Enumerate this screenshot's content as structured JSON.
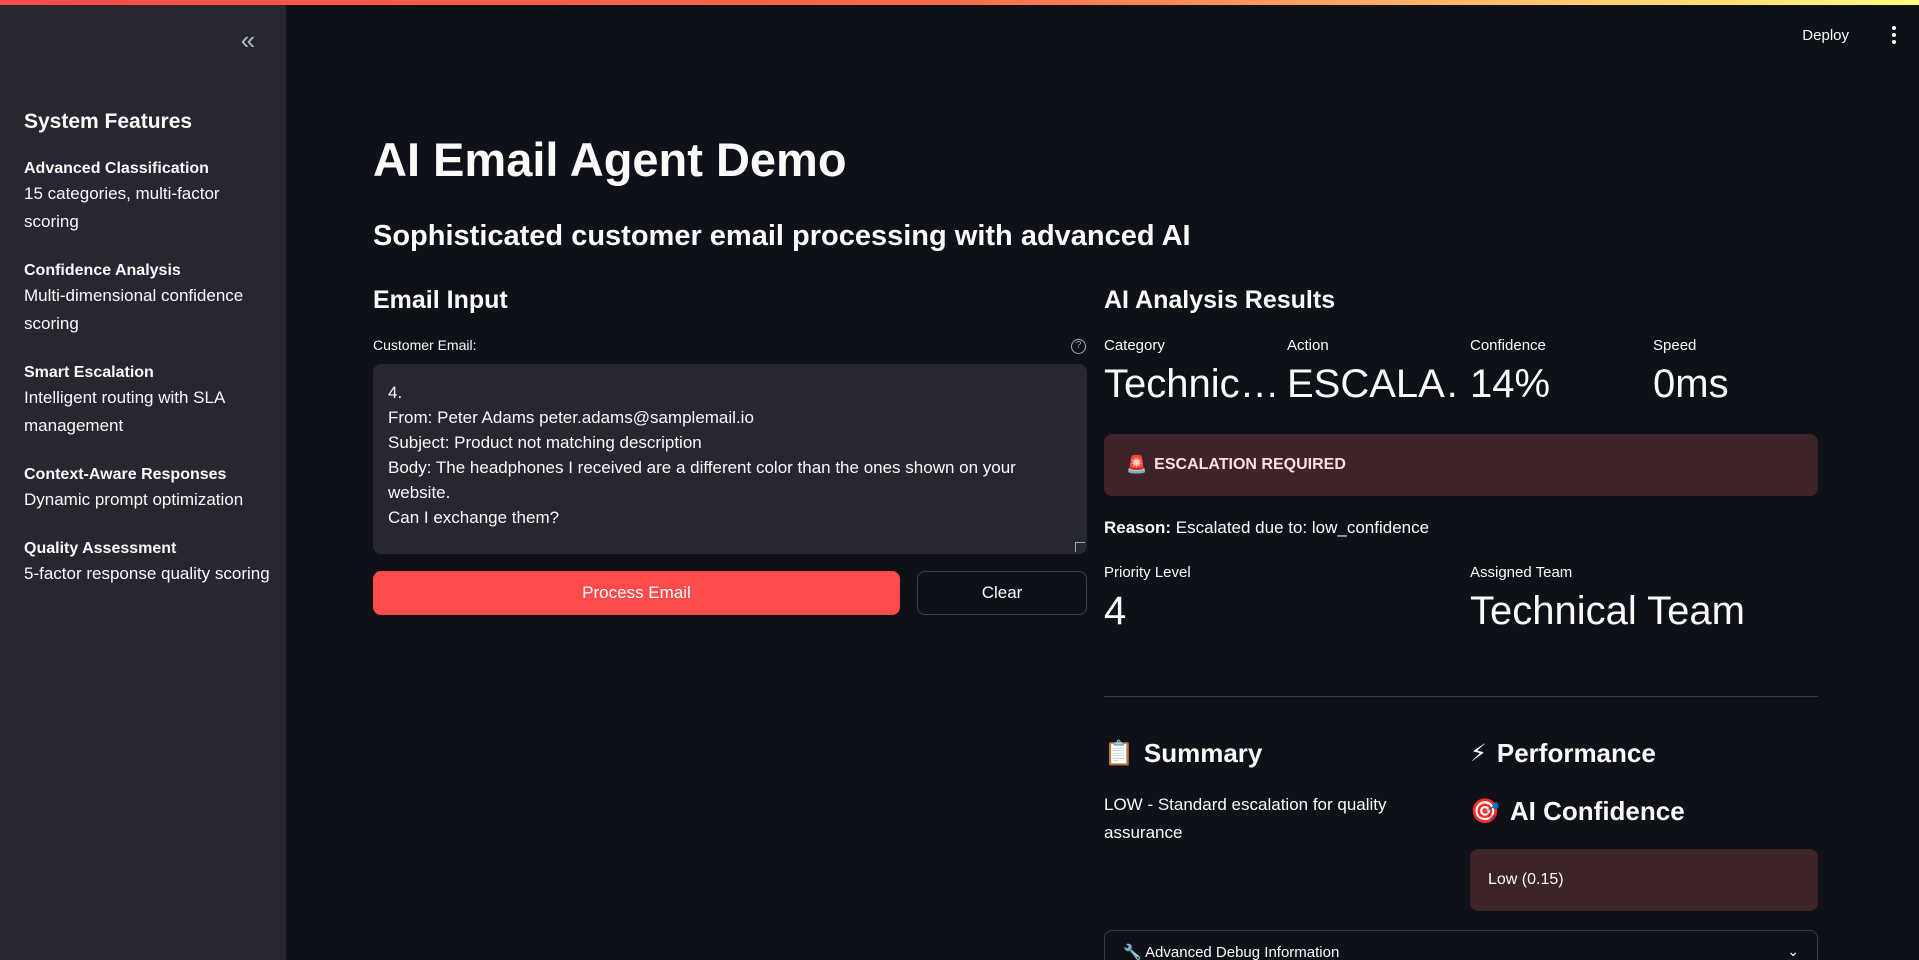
{
  "sidebar": {
    "collapse_icon": "«",
    "title": "System Features",
    "features": [
      {
        "name": "Advanced Classification",
        "desc": "15 categories, multi-factor scoring"
      },
      {
        "name": "Confidence Analysis",
        "desc": "Multi-dimensional confidence scoring"
      },
      {
        "name": "Smart Escalation",
        "desc": "Intelligent routing with SLA management"
      },
      {
        "name": "Context-Aware Responses",
        "desc": "Dynamic prompt optimization"
      },
      {
        "name": "Quality Assessment",
        "desc": "5-factor response quality scoring"
      }
    ]
  },
  "header": {
    "deploy_label": "Deploy"
  },
  "main": {
    "title": "AI Email Agent Demo",
    "subtitle": "Sophisticated customer email processing with advanced AI"
  },
  "email_input": {
    "heading": "Email Input",
    "label": "Customer Email:",
    "help_icon": "?",
    "value": "4.\nFrom: Peter Adams peter.adams@samplemail.io\nSubject: Product not matching description\nBody: The headphones I received are a different color than the ones shown on your website.\nCan I exchange them?",
    "process_label": "Process Email",
    "clear_label": "Clear"
  },
  "results": {
    "heading": "AI Analysis Results",
    "metrics": [
      {
        "label": "Category",
        "value": "Technic…"
      },
      {
        "label": "Action",
        "value": "ESCALA…"
      },
      {
        "label": "Confidence",
        "value": "14%"
      },
      {
        "label": "Speed",
        "value": "0ms"
      }
    ],
    "escalation_icon": "🚨",
    "escalation_text": "ESCALATION REQUIRED",
    "reason_label": "Reason:",
    "reason_text": " Escalated due to: low_confidence",
    "priority_label": "Priority Level",
    "priority_value": "4",
    "team_label": "Assigned Team",
    "team_value": "Technical Team"
  },
  "summary": {
    "icon": "📋",
    "heading": "Summary",
    "text": "LOW - Standard escalation for quality assurance"
  },
  "performance": {
    "icon": "⚡",
    "heading": "Performance"
  },
  "ai_confidence": {
    "icon": "🎯",
    "heading": "AI Confidence",
    "value": "Low (0.15)"
  },
  "debug": {
    "icon": "🔧",
    "label": "Advanced Debug Information",
    "chevron": "⌄"
  },
  "colors": {
    "accent": "#ff4b4b",
    "background": "#0e1117",
    "sidebar": "#262730",
    "alert": "#3e2428"
  }
}
